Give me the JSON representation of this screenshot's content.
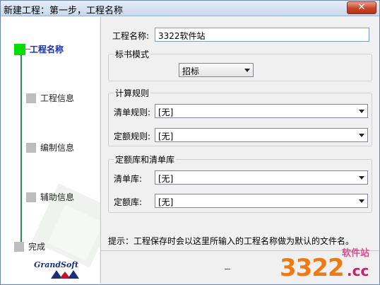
{
  "window": {
    "title": "新建工程：第一步，工程名称",
    "close_glyph": "✕"
  },
  "steps": [
    {
      "label": "工程名称",
      "active": true
    },
    {
      "label": "工程信息",
      "active": false
    },
    {
      "label": "编制信息",
      "active": false
    },
    {
      "label": "辅助信息",
      "active": false
    },
    {
      "label": "完成",
      "active": false
    }
  ],
  "logo": {
    "text": "GrandSoft"
  },
  "form": {
    "project_name_label": "工程名称:",
    "project_name_value": "3322软件站",
    "bid_mode": {
      "title": "标书模式",
      "selected": "招标"
    },
    "calc_rules": {
      "title": "计算规则",
      "bill_rule_label": "清单规则:",
      "bill_rule_value": "[无]",
      "quota_rule_label": "定额规则:",
      "quota_rule_value": "[无]"
    },
    "libraries": {
      "title": "定额库和清单库",
      "bill_lib_label": "清单库:",
      "bill_lib_value": "[无]",
      "quota_lib_label": "定额库:",
      "quota_lib_value": "[无]"
    },
    "hint": "提示：工程保存时会以这里所输入的工程名称做为默认的文件名。"
  },
  "watermark": {
    "site": "软件站",
    "number": "3322",
    "domain": ".cc"
  },
  "colors": {
    "active_step": "#00e000",
    "active_label": "#1530b0",
    "line": "#2e8b57"
  }
}
